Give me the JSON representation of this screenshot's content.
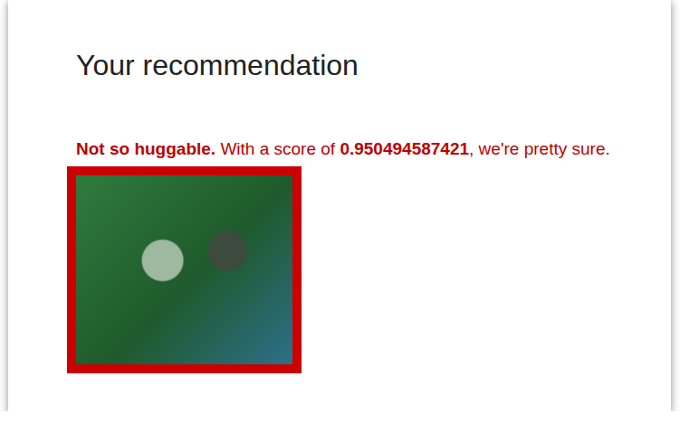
{
  "page": {
    "heading": "Your recommendation"
  },
  "result": {
    "verdict": "Not so huggable.",
    "score_prefix": "With a score of ",
    "score": "0.950494587421",
    "score_suffix": ", we're pretty sure."
  },
  "photo": {
    "kind": "photograph"
  }
}
